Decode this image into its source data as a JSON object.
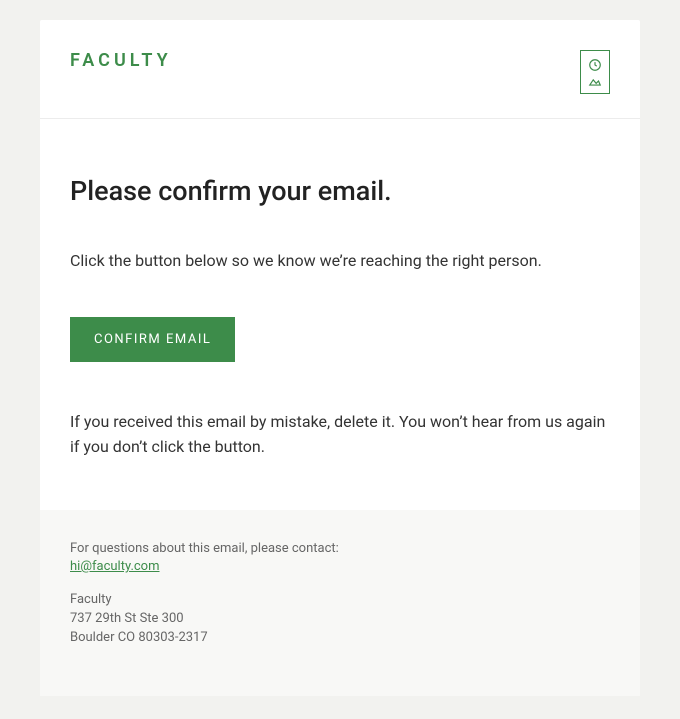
{
  "header": {
    "logo_text": "FACULTY"
  },
  "main": {
    "title": "Please confirm your email.",
    "lead": "Click the button below so we know we’re reaching the right person.",
    "confirm_button": "CONFIRM EMAIL",
    "note": "If you received this email by mistake, delete it. You won’t hear from us again if you don’t click the button."
  },
  "footer": {
    "contact_prompt": "For questions about this email, please contact:",
    "contact_email": "hi@faculty.com",
    "company_name": "Faculty",
    "address_line1": "737 29th St Ste 300",
    "address_line2": "Boulder CO 80303-2317"
  }
}
